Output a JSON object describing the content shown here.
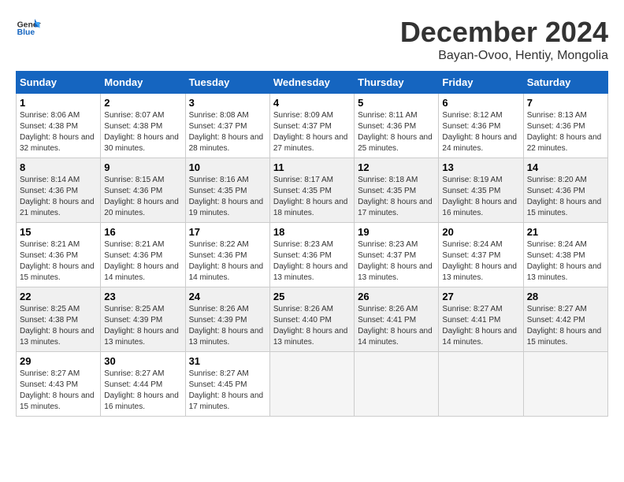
{
  "logo": {
    "text_general": "General",
    "text_blue": "Blue"
  },
  "title": {
    "month": "December 2024",
    "location": "Bayan-Ovoo, Hentiy, Mongolia"
  },
  "weekdays": [
    "Sunday",
    "Monday",
    "Tuesday",
    "Wednesday",
    "Thursday",
    "Friday",
    "Saturday"
  ],
  "weeks": [
    [
      {
        "day": "1",
        "sunrise": "8:06 AM",
        "sunset": "4:38 PM",
        "daylight": "8 hours and 32 minutes."
      },
      {
        "day": "2",
        "sunrise": "8:07 AM",
        "sunset": "4:38 PM",
        "daylight": "8 hours and 30 minutes."
      },
      {
        "day": "3",
        "sunrise": "8:08 AM",
        "sunset": "4:37 PM",
        "daylight": "8 hours and 28 minutes."
      },
      {
        "day": "4",
        "sunrise": "8:09 AM",
        "sunset": "4:37 PM",
        "daylight": "8 hours and 27 minutes."
      },
      {
        "day": "5",
        "sunrise": "8:11 AM",
        "sunset": "4:36 PM",
        "daylight": "8 hours and 25 minutes."
      },
      {
        "day": "6",
        "sunrise": "8:12 AM",
        "sunset": "4:36 PM",
        "daylight": "8 hours and 24 minutes."
      },
      {
        "day": "7",
        "sunrise": "8:13 AM",
        "sunset": "4:36 PM",
        "daylight": "8 hours and 22 minutes."
      }
    ],
    [
      {
        "day": "8",
        "sunrise": "8:14 AM",
        "sunset": "4:36 PM",
        "daylight": "8 hours and 21 minutes."
      },
      {
        "day": "9",
        "sunrise": "8:15 AM",
        "sunset": "4:36 PM",
        "daylight": "8 hours and 20 minutes."
      },
      {
        "day": "10",
        "sunrise": "8:16 AM",
        "sunset": "4:35 PM",
        "daylight": "8 hours and 19 minutes."
      },
      {
        "day": "11",
        "sunrise": "8:17 AM",
        "sunset": "4:35 PM",
        "daylight": "8 hours and 18 minutes."
      },
      {
        "day": "12",
        "sunrise": "8:18 AM",
        "sunset": "4:35 PM",
        "daylight": "8 hours and 17 minutes."
      },
      {
        "day": "13",
        "sunrise": "8:19 AM",
        "sunset": "4:35 PM",
        "daylight": "8 hours and 16 minutes."
      },
      {
        "day": "14",
        "sunrise": "8:20 AM",
        "sunset": "4:36 PM",
        "daylight": "8 hours and 15 minutes."
      }
    ],
    [
      {
        "day": "15",
        "sunrise": "8:21 AM",
        "sunset": "4:36 PM",
        "daylight": "8 hours and 15 minutes."
      },
      {
        "day": "16",
        "sunrise": "8:21 AM",
        "sunset": "4:36 PM",
        "daylight": "8 hours and 14 minutes."
      },
      {
        "day": "17",
        "sunrise": "8:22 AM",
        "sunset": "4:36 PM",
        "daylight": "8 hours and 14 minutes."
      },
      {
        "day": "18",
        "sunrise": "8:23 AM",
        "sunset": "4:36 PM",
        "daylight": "8 hours and 13 minutes."
      },
      {
        "day": "19",
        "sunrise": "8:23 AM",
        "sunset": "4:37 PM",
        "daylight": "8 hours and 13 minutes."
      },
      {
        "day": "20",
        "sunrise": "8:24 AM",
        "sunset": "4:37 PM",
        "daylight": "8 hours and 13 minutes."
      },
      {
        "day": "21",
        "sunrise": "8:24 AM",
        "sunset": "4:38 PM",
        "daylight": "8 hours and 13 minutes."
      }
    ],
    [
      {
        "day": "22",
        "sunrise": "8:25 AM",
        "sunset": "4:38 PM",
        "daylight": "8 hours and 13 minutes."
      },
      {
        "day": "23",
        "sunrise": "8:25 AM",
        "sunset": "4:39 PM",
        "daylight": "8 hours and 13 minutes."
      },
      {
        "day": "24",
        "sunrise": "8:26 AM",
        "sunset": "4:39 PM",
        "daylight": "8 hours and 13 minutes."
      },
      {
        "day": "25",
        "sunrise": "8:26 AM",
        "sunset": "4:40 PM",
        "daylight": "8 hours and 13 minutes."
      },
      {
        "day": "26",
        "sunrise": "8:26 AM",
        "sunset": "4:41 PM",
        "daylight": "8 hours and 14 minutes."
      },
      {
        "day": "27",
        "sunrise": "8:27 AM",
        "sunset": "4:41 PM",
        "daylight": "8 hours and 14 minutes."
      },
      {
        "day": "28",
        "sunrise": "8:27 AM",
        "sunset": "4:42 PM",
        "daylight": "8 hours and 15 minutes."
      }
    ],
    [
      {
        "day": "29",
        "sunrise": "8:27 AM",
        "sunset": "4:43 PM",
        "daylight": "8 hours and 15 minutes."
      },
      {
        "day": "30",
        "sunrise": "8:27 AM",
        "sunset": "4:44 PM",
        "daylight": "8 hours and 16 minutes."
      },
      {
        "day": "31",
        "sunrise": "8:27 AM",
        "sunset": "4:45 PM",
        "daylight": "8 hours and 17 minutes."
      },
      null,
      null,
      null,
      null
    ]
  ],
  "labels": {
    "sunrise": "Sunrise:",
    "sunset": "Sunset:",
    "daylight": "Daylight:"
  }
}
